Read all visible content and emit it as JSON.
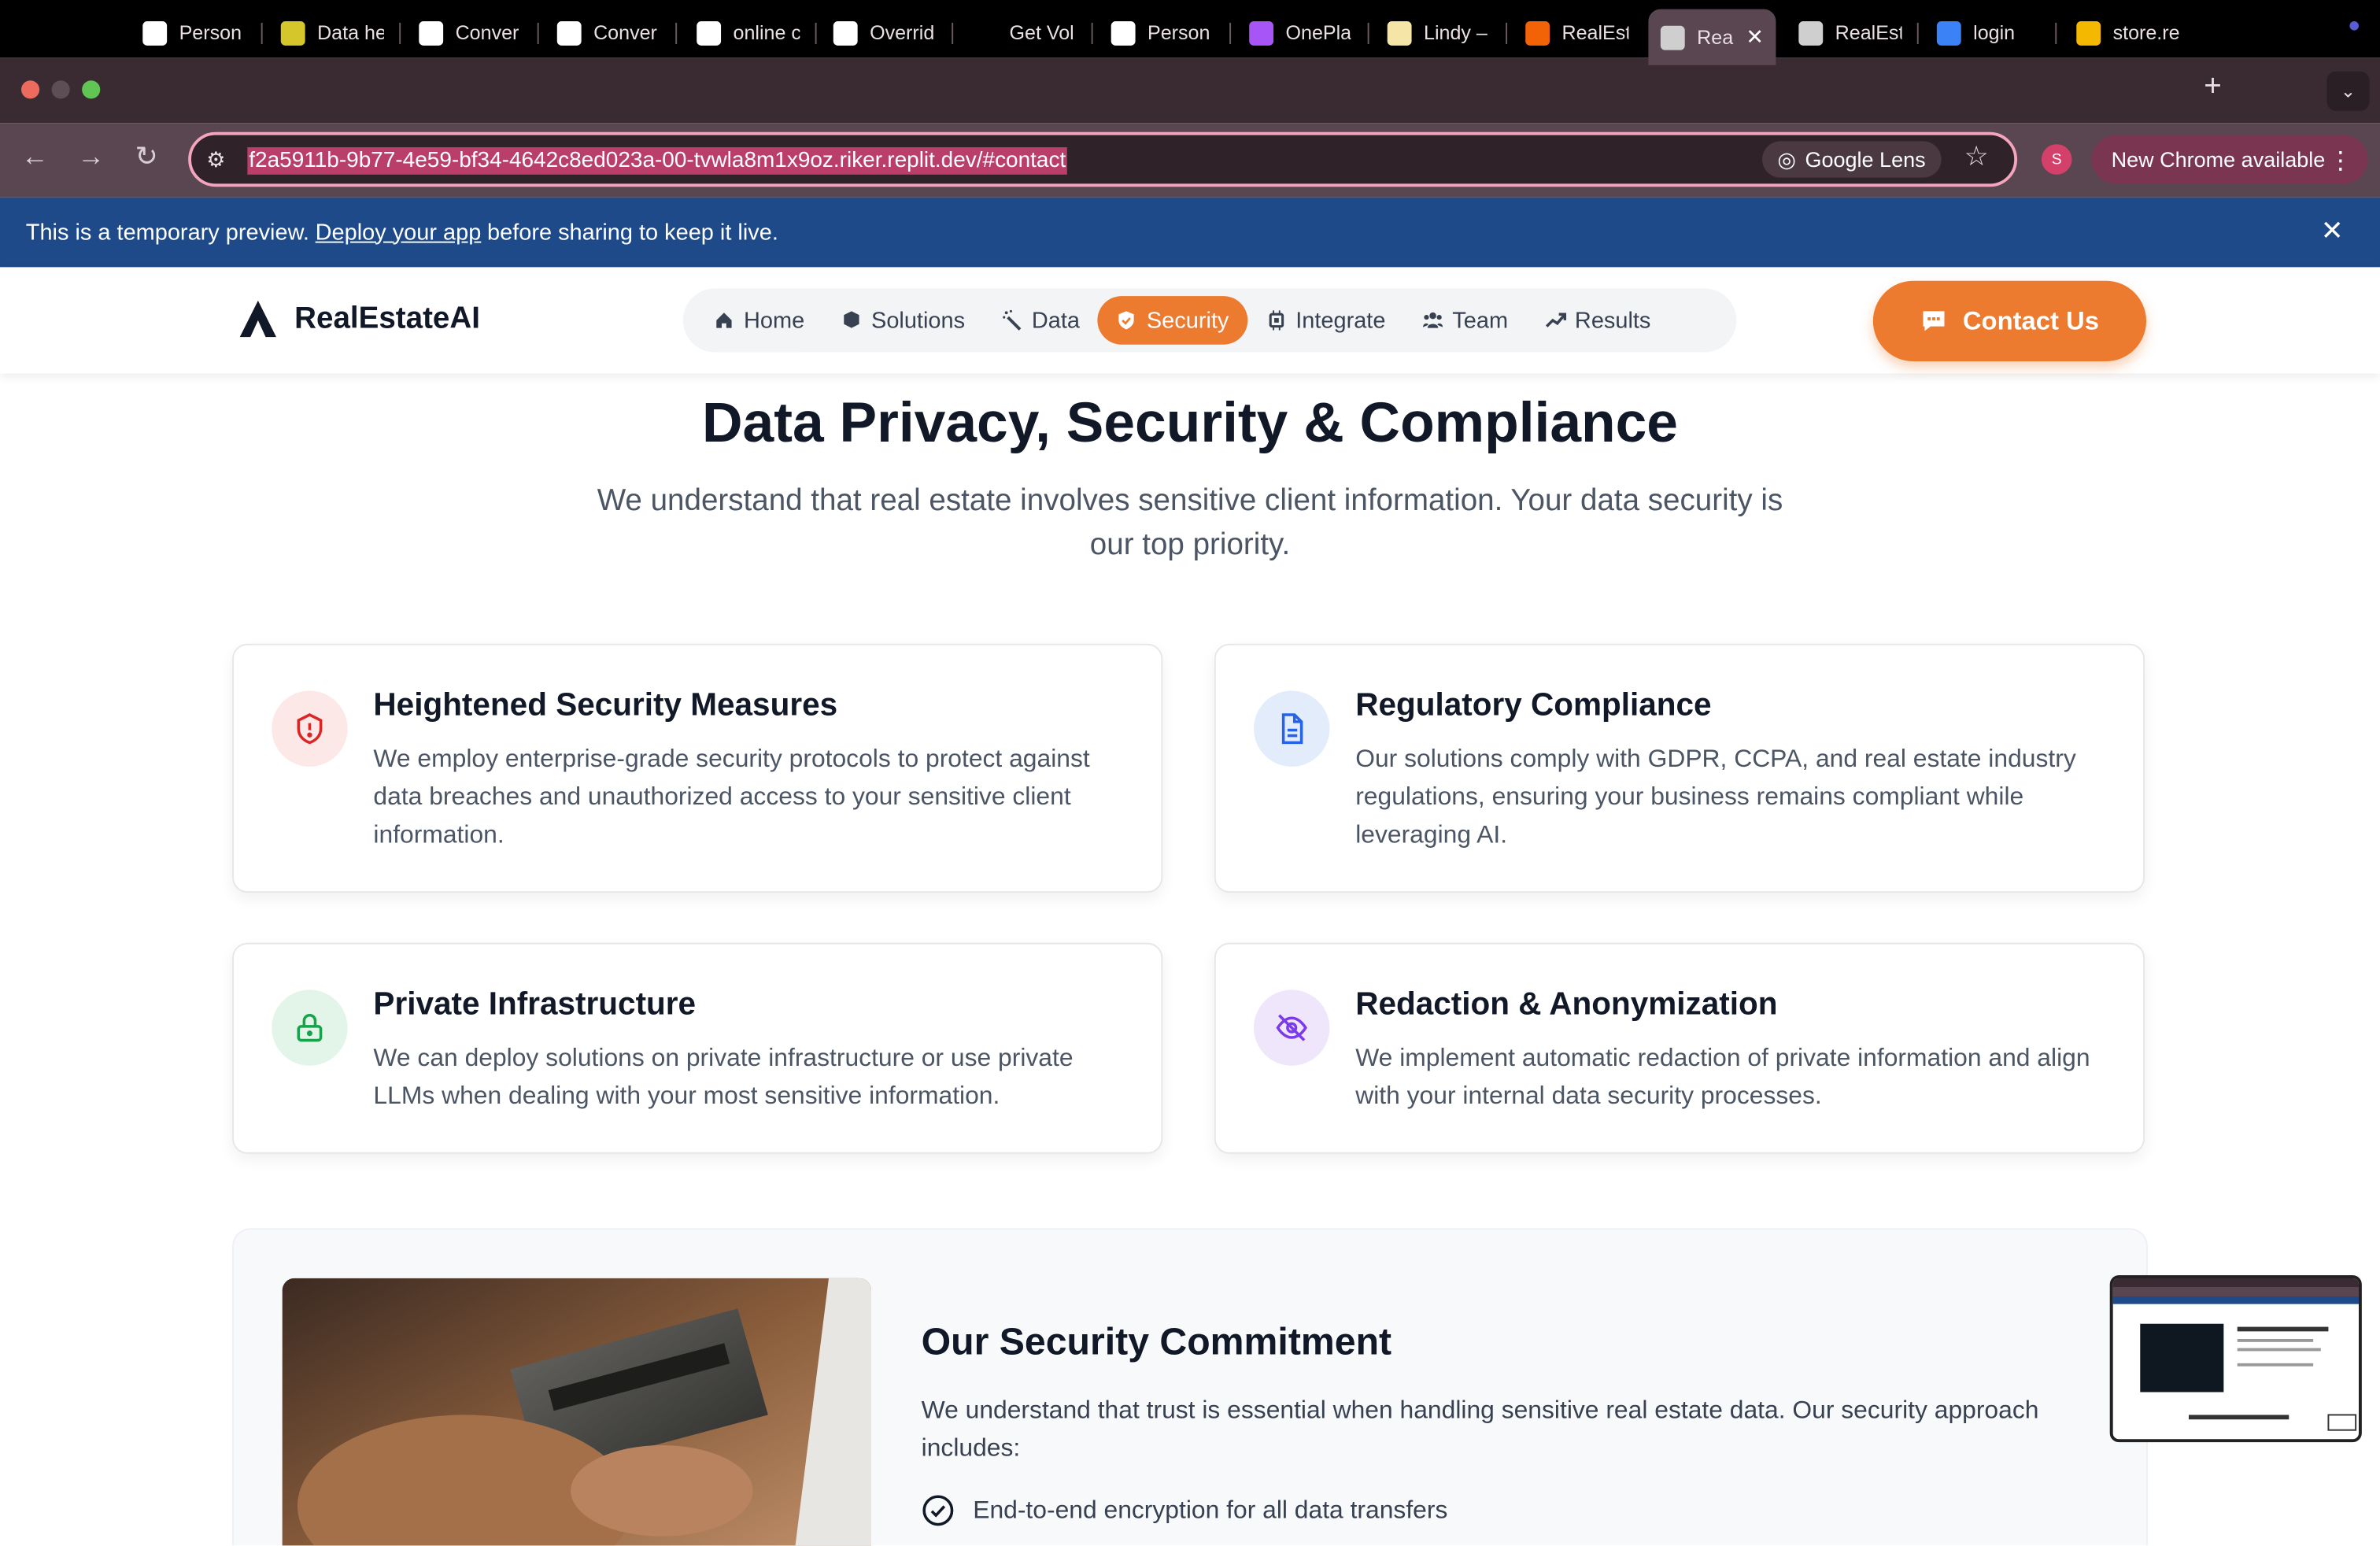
{
  "browser": {
    "tabs": [
      {
        "title": "Person",
        "favicon": "google-icon",
        "fav_color": "#ffffff"
      },
      {
        "title": "Data he",
        "favicon": "perplexity-icon",
        "fav_color": "#d4c62b"
      },
      {
        "title": "Conver",
        "favicon": "pause-app-icon",
        "fav_color": "#ffffff"
      },
      {
        "title": "Conver",
        "favicon": "pause-app-icon",
        "fav_color": "#ffffff"
      },
      {
        "title": "online c",
        "favicon": "google-icon",
        "fav_color": "#ffffff"
      },
      {
        "title": "Overrid",
        "favicon": "record-icon",
        "fav_color": "#ffffff"
      },
      {
        "title": "Get Vol",
        "favicon": "p-logo-icon",
        "fav_color": "#000000"
      },
      {
        "title": "Person",
        "favicon": "google-icon",
        "fav_color": "#ffffff"
      },
      {
        "title": "OnePla",
        "favicon": "oneplace-icon",
        "fav_color": "#a855f7"
      },
      {
        "title": "Lindy –",
        "favicon": "lindy-icon",
        "fav_color": "#f5e6a8"
      },
      {
        "title": "RealEst",
        "favicon": "replit-icon",
        "fav_color": "#f26207"
      },
      {
        "title": "Rea",
        "favicon": "globe-icon",
        "fav_color": "#cfcfcf",
        "active": true
      },
      {
        "title": "RealEst",
        "favicon": "globe-icon",
        "fav_color": "#cfcfcf"
      },
      {
        "title": "login",
        "favicon": "cube-icon",
        "fav_color": "#3b82f6"
      },
      {
        "title": "store.re",
        "favicon": "r-logo-icon",
        "fav_color": "#f5b800"
      }
    ],
    "url": "f2a5911b-9b77-4e59-bf34-4642c8ed023a-00-tvwla8m1x9oz.riker.replit.dev/#contact",
    "google_lens": "Google Lens",
    "profile_initial": "S",
    "new_chrome": "New Chrome available"
  },
  "banner": {
    "prefix": "This is a temporary preview.",
    "link": "Deploy your app",
    "suffix": "before sharing to keep it live."
  },
  "site": {
    "brand": "RealEstateAI",
    "nav": [
      {
        "label": "Home",
        "icon": "home-icon"
      },
      {
        "label": "Solutions",
        "icon": "cube-icon"
      },
      {
        "label": "Data",
        "icon": "magic-wand-icon"
      },
      {
        "label": "Security",
        "icon": "shield-icon",
        "active": true
      },
      {
        "label": "Integrate",
        "icon": "chip-icon"
      },
      {
        "label": "Team",
        "icon": "users-icon"
      },
      {
        "label": "Results",
        "icon": "trend-up-icon"
      }
    ],
    "contact": "Contact Us"
  },
  "section": {
    "title": "Data Privacy, Security & Compliance",
    "subtitle": "We understand that real estate involves sensitive client information. Your data security is our top priority.",
    "cards": [
      {
        "title": "Heightened Security Measures",
        "body": "We employ enterprise-grade security protocols to protect against data breaches and unauthorized access to your sensitive client information.",
        "icon": "shield-alert-icon",
        "icon_color": "#dc2626",
        "icon_bg": "#fde8e8"
      },
      {
        "title": "Regulatory Compliance",
        "body": "Our solutions comply with GDPR, CCPA, and real estate industry regulations, ensuring your business remains compliant while leveraging AI.",
        "icon": "document-icon",
        "icon_color": "#2563eb",
        "icon_bg": "#e3ecfb"
      },
      {
        "title": "Private Infrastructure",
        "body": "We can deploy solutions on private infrastructure or use private LLMs when dealing with your most sensitive information.",
        "icon": "lock-icon",
        "icon_color": "#16a34a",
        "icon_bg": "#e3f5e9"
      },
      {
        "title": "Redaction & Anonymization",
        "body": "We implement automatic redaction of private information and align with your internal data security processes.",
        "icon": "eye-off-icon",
        "icon_color": "#7c3aed",
        "icon_bg": "#efe6fb"
      }
    ]
  },
  "commitment": {
    "title": "Our Security Commitment",
    "body": "We understand that trust is essential when handling sensitive real estate data. Our security approach includes:",
    "items": [
      "End-to-end encryption for all data transfers"
    ]
  },
  "colors": {
    "accent": "#ec7a2f",
    "banner": "#1e4a8a"
  }
}
